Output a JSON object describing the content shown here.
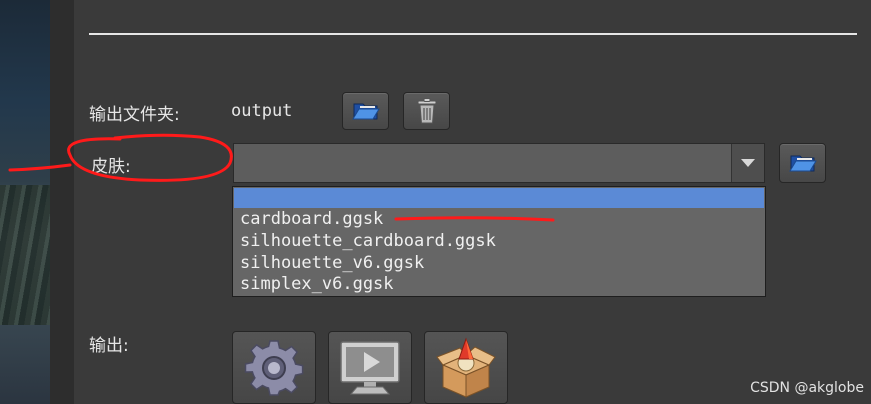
{
  "output_folder": {
    "label": "输出文件夹:",
    "value": "output",
    "browse_icon": "folder-open-icon",
    "delete_icon": "trash-icon"
  },
  "skin": {
    "label": "皮肤:",
    "selected": "",
    "browse_icon": "folder-open-icon",
    "options": [
      "",
      "cardboard.ggsk",
      "silhouette_cardboard.ggsk",
      "silhouette_v6.ggsk",
      "simplex_v6.ggsk"
    ]
  },
  "output": {
    "label": "输出:",
    "buttons": [
      {
        "icon": "gear-icon"
      },
      {
        "icon": "monitor-play-icon"
      },
      {
        "icon": "package-box-icon"
      }
    ]
  },
  "colors": {
    "background": "#3a3a3a",
    "dropdown_highlight": "#5b8ad6",
    "annotation": "#ff1a1a"
  },
  "watermark": "CSDN @akglobe"
}
